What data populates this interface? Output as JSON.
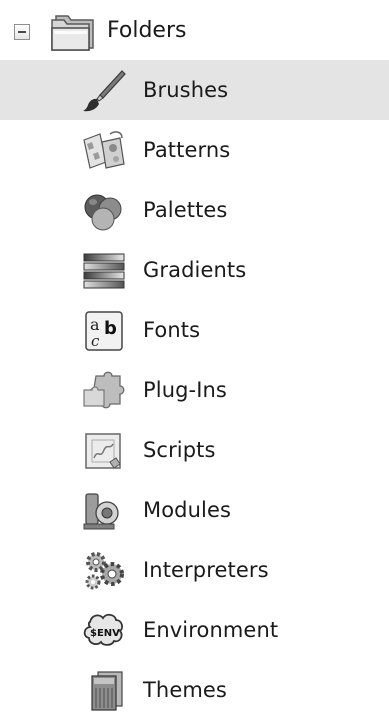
{
  "tree": {
    "root": {
      "label": "Folders",
      "expanded": true
    },
    "selected_index": 0,
    "items": [
      {
        "label": "Brushes",
        "icon": "brush-icon"
      },
      {
        "label": "Patterns",
        "icon": "patterns-icon"
      },
      {
        "label": "Palettes",
        "icon": "palettes-icon"
      },
      {
        "label": "Gradients",
        "icon": "gradients-icon"
      },
      {
        "label": "Fonts",
        "icon": "fonts-icon"
      },
      {
        "label": "Plug-Ins",
        "icon": "puzzle-icon"
      },
      {
        "label": "Scripts",
        "icon": "scripts-icon"
      },
      {
        "label": "Modules",
        "icon": "modules-icon"
      },
      {
        "label": "Interpreters",
        "icon": "gears-icon"
      },
      {
        "label": "Environment",
        "icon": "env-icon"
      },
      {
        "label": "Themes",
        "icon": "themes-icon"
      }
    ]
  }
}
